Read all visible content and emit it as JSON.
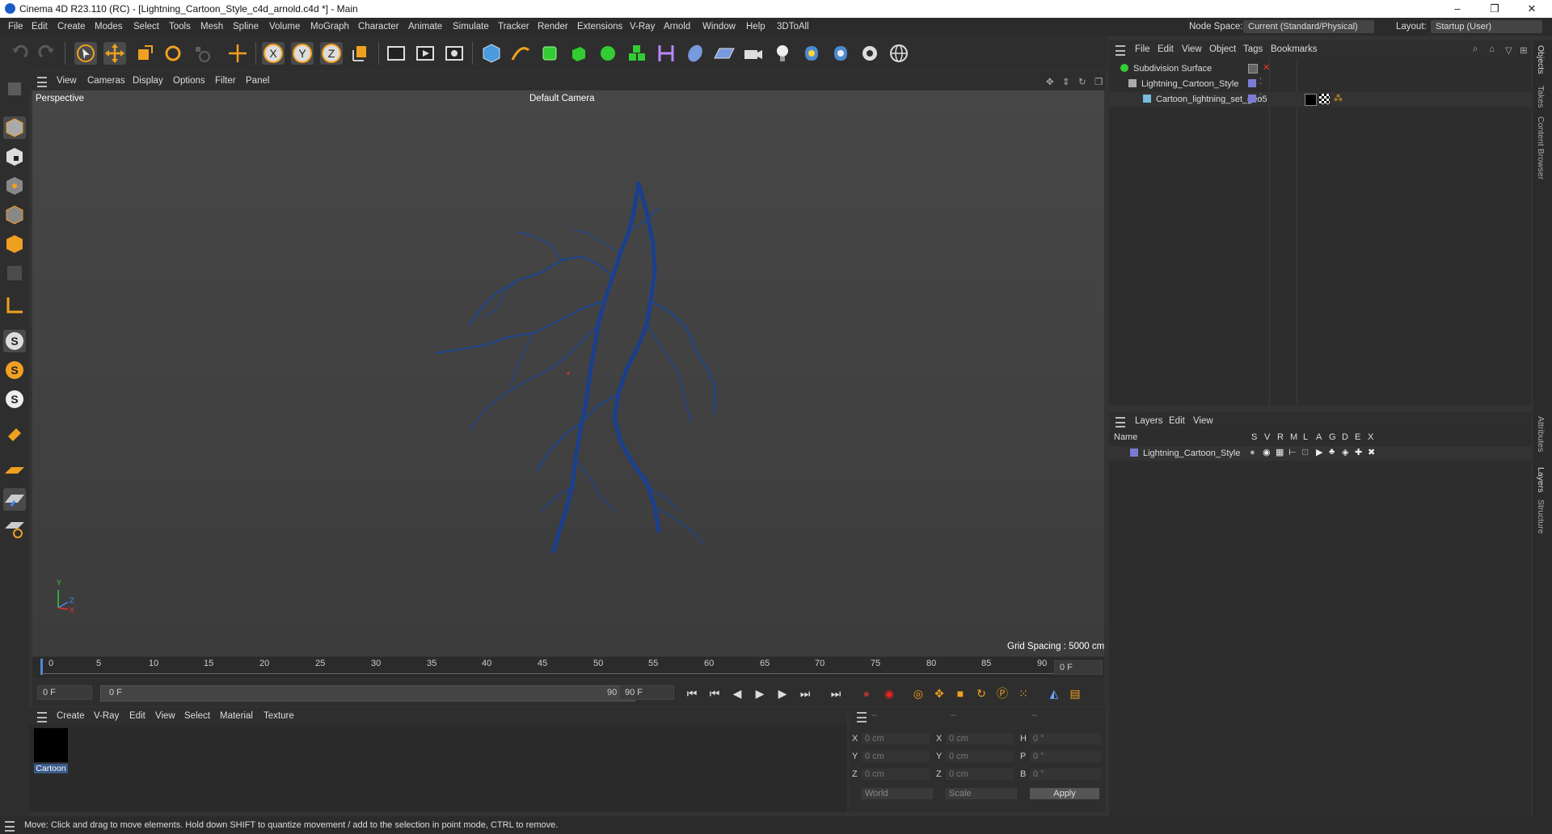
{
  "window": {
    "title": "Cinema 4D R23.110 (RC) - [Lightning_Cartoon_Style_c4d_arnold.c4d *] - Main",
    "controls": [
      "–",
      "❐",
      "✕"
    ]
  },
  "menubar": {
    "items": [
      "File",
      "Edit",
      "Create",
      "Modes",
      "Select",
      "Tools",
      "Mesh",
      "Spline",
      "Volume",
      "MoGraph",
      "Character",
      "Animate",
      "Simulate",
      "Tracker",
      "Render",
      "Extensions",
      "V-Ray",
      "Arnold",
      "Window",
      "Help",
      "3DToAll"
    ],
    "node_space_label": "Node Space:",
    "node_space_value": "Current (Standard/Physical)",
    "layout_label": "Layout:",
    "layout_value": "Startup (User)"
  },
  "viewport": {
    "menu": [
      "View",
      "Cameras",
      "Display",
      "Options",
      "Filter",
      "Panel"
    ],
    "projection": "Perspective",
    "camera": "Default Camera",
    "grid_spacing": "Grid Spacing : 5000 cm",
    "axis_labels": {
      "y": "Y",
      "z": "Z",
      "x": "X"
    },
    "lightning_color": "#1a3f8a"
  },
  "timeline": {
    "ticks": [
      "0",
      "5",
      "10",
      "15",
      "20",
      "25",
      "30",
      "35",
      "40",
      "45",
      "50",
      "55",
      "60",
      "65",
      "70",
      "75",
      "80",
      "85",
      "90"
    ],
    "current_frame": "0 F"
  },
  "transport": {
    "start_field": "0 F",
    "range_start": "0 F",
    "range_end": "90 F",
    "end_field": "90 F"
  },
  "material_manager": {
    "menu": [
      "Create",
      "V-Ray",
      "Edit",
      "View",
      "Select",
      "Material",
      "Texture"
    ],
    "materials": [
      {
        "name": "Cartoon",
        "color": "#000000"
      }
    ]
  },
  "coordinates": {
    "headers": [
      "--",
      "--",
      "--"
    ],
    "rows": [
      {
        "a": "X",
        "av": "0 cm",
        "b": "X",
        "bv": "0 cm",
        "c": "H",
        "cv": "0 °"
      },
      {
        "a": "Y",
        "av": "0 cm",
        "b": "Y",
        "bv": "0 cm",
        "c": "P",
        "cv": "0 °"
      },
      {
        "a": "Z",
        "av": "0 cm",
        "b": "Z",
        "bv": "0 cm",
        "c": "B",
        "cv": "0 °"
      }
    ],
    "space": "World",
    "mode": "Scale",
    "apply": "Apply"
  },
  "object_manager": {
    "menu": [
      "File",
      "Edit",
      "View",
      "Object",
      "Tags",
      "Bookmarks"
    ],
    "objects": [
      {
        "name": "Subdivision Surface"
      },
      {
        "name": "Lightning_Cartoon_Style"
      },
      {
        "name": "Cartoon_lightning_set_geo5"
      }
    ]
  },
  "layer_manager": {
    "menu": [
      "Layers",
      "Edit",
      "View"
    ],
    "columns": [
      "Name",
      "S",
      "V",
      "R",
      "M",
      "L",
      "A",
      "G",
      "D",
      "E",
      "X"
    ],
    "layers": [
      {
        "name": "Lightning_Cartoon_Style",
        "color": "#7b7bd6"
      }
    ]
  },
  "right_dock_tabs": [
    "Objects",
    "Takes",
    "Content Browser",
    "Attributes",
    "Layers",
    "Structure"
  ],
  "status": "Move: Click and drag to move elements. Hold down SHIFT to quantize movement / add to the selection in point mode, CTRL to remove."
}
